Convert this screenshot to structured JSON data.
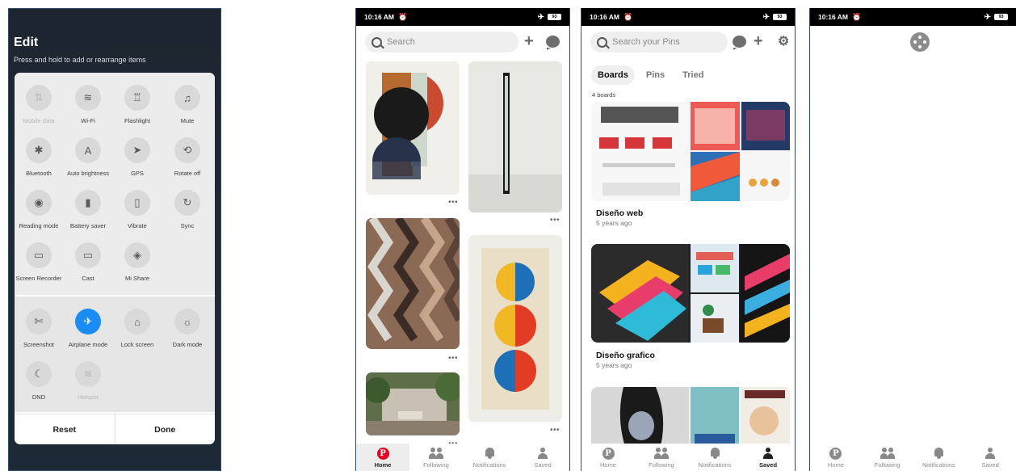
{
  "edit_panel": {
    "title": "Edit",
    "subtitle": "Press and hold to add or rearrange items",
    "active_tiles": [
      {
        "label": "Mobile data",
        "icon": "mobile-data-icon",
        "glyph": "⇅",
        "enabled": false
      },
      {
        "label": "Wi-Fi",
        "icon": "wifi-icon",
        "glyph": "≋",
        "enabled": true
      },
      {
        "label": "Flashlight",
        "icon": "flashlight-icon",
        "glyph": "♖",
        "enabled": true
      },
      {
        "label": "Mute",
        "icon": "bell-icon",
        "glyph": "♫",
        "enabled": true
      },
      {
        "label": "Bluetooth",
        "icon": "bluetooth-icon",
        "glyph": "✱",
        "enabled": true
      },
      {
        "label": "Auto brightness",
        "icon": "auto-brightness-icon",
        "glyph": "A",
        "enabled": true
      },
      {
        "label": "GPS",
        "icon": "gps-icon",
        "glyph": "➤",
        "enabled": true
      },
      {
        "label": "Rotate off",
        "icon": "rotate-lock-icon",
        "glyph": "⟲",
        "enabled": true
      },
      {
        "label": "Reading mode",
        "icon": "eye-icon",
        "glyph": "◉",
        "enabled": true
      },
      {
        "label": "Battery saver",
        "icon": "battery-icon",
        "glyph": "▮",
        "enabled": true
      },
      {
        "label": "Vibrate",
        "icon": "vibrate-icon",
        "glyph": "▯",
        "enabled": true
      },
      {
        "label": "Sync",
        "icon": "sync-icon",
        "glyph": "↻",
        "enabled": true
      },
      {
        "label": "Screen Recorder",
        "icon": "video-camera-icon",
        "glyph": "▭",
        "enabled": true
      },
      {
        "label": "Cast",
        "icon": "monitor-icon",
        "glyph": "▭",
        "enabled": true
      },
      {
        "label": "Mi Share",
        "icon": "mi-share-icon",
        "glyph": "◈",
        "enabled": true
      }
    ],
    "inactive_tiles": [
      {
        "label": "Screenshot",
        "icon": "screenshot-icon",
        "glyph": "✄",
        "enabled": true
      },
      {
        "label": "Airplane mode",
        "icon": "airplane-icon",
        "glyph": "✈",
        "enabled": true,
        "highlight": true
      },
      {
        "label": "Lock screen",
        "icon": "lock-icon",
        "glyph": "⌂",
        "enabled": true
      },
      {
        "label": "Dark mode",
        "icon": "sun-icon",
        "glyph": "☼",
        "enabled": true
      },
      {
        "label": "DND",
        "icon": "moon-icon",
        "glyph": "☾",
        "enabled": true
      },
      {
        "label": "Hotspot",
        "icon": "hotspot-icon",
        "glyph": "≋",
        "enabled": false
      }
    ],
    "reset_label": "Reset",
    "done_label": "Done"
  },
  "status_bar": {
    "time": "10:16 AM",
    "battery": "93"
  },
  "home_feed": {
    "search_placeholder": "Search",
    "more_label": "•••"
  },
  "saved_screen": {
    "search_placeholder": "Search your Pins",
    "tabs": [
      "Boards",
      "Pins",
      "Tried"
    ],
    "active_tab": "Boards",
    "board_count": "4 boards",
    "boards": [
      {
        "title": "Diseño web",
        "subtitle": "5 years ago"
      },
      {
        "title": "Diseño grafico",
        "subtitle": "5 years ago"
      }
    ]
  },
  "bottom_nav": {
    "items": [
      "Home",
      "Following",
      "Notifications",
      "Saved"
    ]
  },
  "colors": {
    "accent_blue": "#1a8cf5",
    "pinterest_red": "#e60023"
  }
}
